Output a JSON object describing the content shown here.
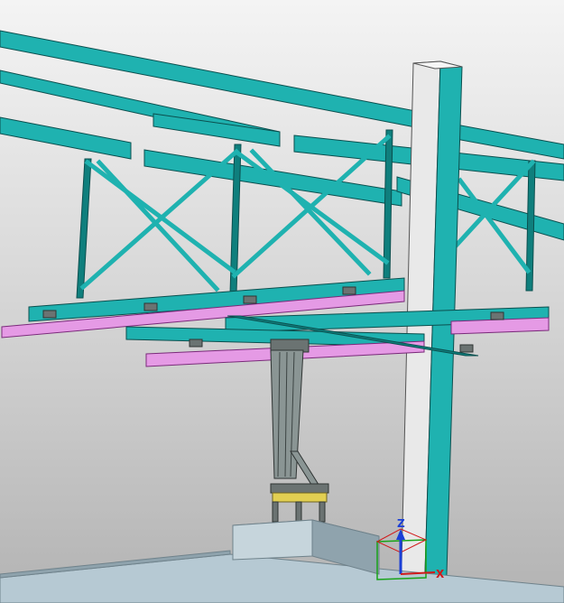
{
  "viewport": {
    "background_top": "#f4f4f4",
    "background_bottom": "#b3b3b3"
  },
  "colors": {
    "steel": "#1fb2b0",
    "steel_dark": "#0f7f7d",
    "steel_edge": "#0b4f4e",
    "rail": "#e59ae5",
    "rail_edge": "#7a2a7a",
    "column_face": "#e9e9e9",
    "column_side": "#c7c7c7",
    "floor": "#b6c9d3",
    "floor_side": "#8fa3ad",
    "pedestal": "#c6d5dc",
    "carriage": "#e2cf52",
    "machinery": "#6b7372"
  },
  "axes": {
    "z_label": "Z",
    "x_label": "X",
    "z_color": "#1b3fd6",
    "x_color": "#d11a1a",
    "y_color": "#18a318"
  },
  "icons": {
    "triad": "coordinate-triad-icon"
  }
}
